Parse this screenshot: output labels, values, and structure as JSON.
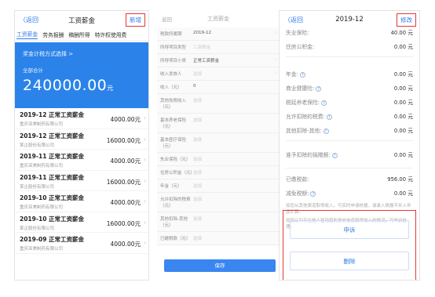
{
  "phone1": {
    "nav": {
      "back": "〈返回",
      "title": "工资薪金",
      "action": "新增"
    },
    "tabs": [
      {
        "label": "工资薪金",
        "active": true
      },
      {
        "label": "劳务报酬",
        "active": false
      },
      {
        "label": "稿酬所得",
        "active": false
      },
      {
        "label": "特许权使用费",
        "active": false
      }
    ],
    "banner": {
      "method": "奖金计税方式选择 >",
      "total_label": "全部合计",
      "amount": "240000.00",
      "unit": "元"
    },
    "rows": [
      {
        "title": "2019-12 正常工资薪金",
        "company": "重庆亚美制药有限公司",
        "amount": "4000.00元"
      },
      {
        "title": "2019-12 正常工资薪金",
        "company": "某企股份有限公司",
        "amount": "16000.00元"
      },
      {
        "title": "2019-11 正常工资薪金",
        "company": "重庆亚美制药有限公司",
        "amount": "4000.00元"
      },
      {
        "title": "2019-11 正常工资薪金",
        "company": "某企股份有限公司",
        "amount": "16000.00元"
      },
      {
        "title": "2019-10 正常工资薪金",
        "company": "重庆亚美制药有限公司",
        "amount": "4000.00元"
      },
      {
        "title": "2019-10 正常工资薪金",
        "company": "某企股份有限公司",
        "amount": "16000.00元"
      },
      {
        "title": "2019-09 正常工资薪金",
        "company": "重庆亚美制药有限公司",
        "amount": "4000.00元"
      }
    ]
  },
  "phone2": {
    "nav": {
      "back": "返回",
      "title": "工资薪金"
    },
    "rows": [
      {
        "k": "税款所属期",
        "v": "2019-12",
        "ph": false
      },
      {
        "k": "所得项目类型",
        "v": "工资薪金",
        "ph": true
      },
      {
        "k": "所得项目小类",
        "v": "正常工资薪金",
        "ph": false
      },
      {
        "k": "收入发放人",
        "v": "选填",
        "ph": true
      },
      {
        "k": "收入（元）",
        "v": "0",
        "ph": false
      },
      {
        "k": "其他免税收入（元）",
        "v": "选填",
        "ph": true
      },
      {
        "k": "基本养老保险（元）",
        "v": "选填",
        "ph": true
      },
      {
        "k": "基本医疗保险（元）",
        "v": "选填",
        "ph": true
      },
      {
        "k": "失业保险（元）",
        "v": "选填",
        "ph": true
      },
      {
        "k": "住房公积金（元）",
        "v": "选填",
        "ph": true
      },
      {
        "k": "年金（元）",
        "v": "选填",
        "ph": true
      },
      {
        "k": "允许扣除的税费（元）",
        "v": "选填",
        "ph": true
      },
      {
        "k": "其他扣除-其他（元）",
        "v": "选填",
        "ph": true
      },
      {
        "k": "已缴税款（元）",
        "v": "选填",
        "ph": true
      }
    ],
    "save": "保存"
  },
  "phone3": {
    "nav": {
      "back": "〈返回",
      "title": "2019-12",
      "action": "修改"
    },
    "top_rows": [
      {
        "k": "失业保险:",
        "v": "40.00 元"
      },
      {
        "k": "住房公积金:",
        "v": "0.00 元"
      }
    ],
    "mid_rows": [
      {
        "k": "年金",
        "v": "0.00 元"
      },
      {
        "k": "商业健康险",
        "v": "0.00 元"
      },
      {
        "k": "税延养老保险",
        "v": "0.00 元"
      },
      {
        "k": "允许扣除的税费",
        "v": "0.00 元"
      },
      {
        "k": "其他扣除-其他",
        "v": "0.00 元"
      }
    ],
    "deduct": {
      "k": "准予扣除的捐赠额",
      "v": "0.00 元"
    },
    "tax_rows": [
      {
        "k": "已缴税款:",
        "v": "956.00 元"
      },
      {
        "k": "减免税额",
        "v": "0.00 元"
      }
    ],
    "note1": "如您从其他渠道取得收入，可实时申请核报，请录入情报不并入年度汇算。",
    "note2": "如您认为存在他人冒用您的身份信息取得收入的情况，可申诉处理。",
    "appeal": "申诉",
    "delete": "删除"
  }
}
